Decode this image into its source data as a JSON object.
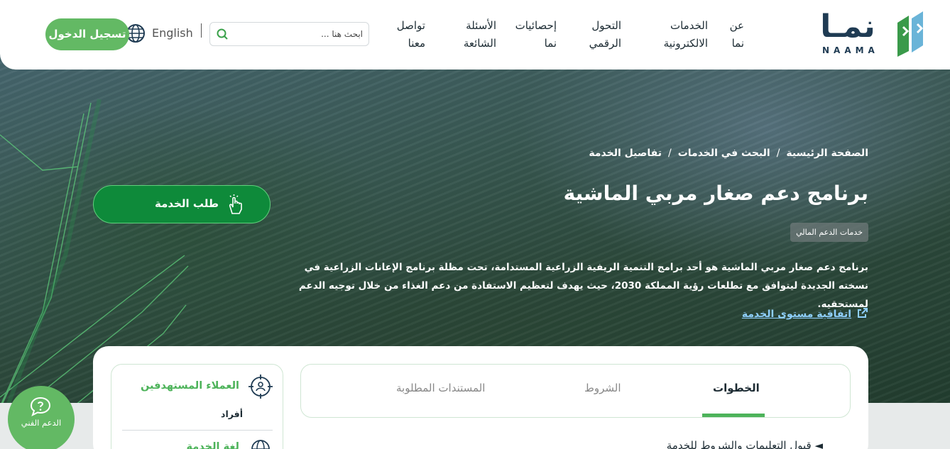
{
  "header": {
    "logo": {
      "arabic": "نمـا",
      "latin": "NAAMA"
    },
    "nav": [
      {
        "label": "عن\nنما"
      },
      {
        "label": "الخدمات\nالالكترونية"
      },
      {
        "label": "التحول\nالرقمي"
      },
      {
        "label": "إحصائيات\nنما"
      },
      {
        "label": "الأسئلة\nالشائعة"
      },
      {
        "label": "تواصل\nمعنا"
      }
    ],
    "search_placeholder": "ابحث هنا ...",
    "language": "English",
    "login_label": "تسجيل الدخول"
  },
  "breadcrumb": [
    "الصفحة الرئيسية",
    "البحث في الخدمات",
    "تفاصيل الخدمة"
  ],
  "service": {
    "title": "برنامج دعم صغار مربي الماشية",
    "category": "خدمات الدعم المالي",
    "description": "برنامج دعم صغار مربي الماشية هو أحد برامج التنمية الريفية الزراعية المستدامة، تحت مظلة برنامج الإعانات الزراعية في نسخته الجديدة ليتوافق مع تطلعات رؤية المملكة 2030، حيث يهدف لتعظيم الاستفادة من دعم الغذاء من خلال توجيه الدعم لمستحقيه.",
    "sla_link": "اتفاقية مستوى الخدمة",
    "request_button": "طلب الخدمة"
  },
  "tabs": [
    {
      "label": "الخطوات",
      "active": true
    },
    {
      "label": "الشروط",
      "active": false
    },
    {
      "label": "المستندات المطلوبة",
      "active": false
    }
  ],
  "steps_first": "قبول التعليمات والشروط للخدمة",
  "sidebar": {
    "beneficiaries_title": "العملاء المستهدفين",
    "beneficiaries_value": "أفراد",
    "second_title": "لغة الخدمة"
  },
  "support_label": "الدعم الفني",
  "colors": {
    "brand_green": "#63b964",
    "dark_green": "#0e8a3a",
    "navy": "#1f3b53",
    "link": "#8fd0ff"
  }
}
